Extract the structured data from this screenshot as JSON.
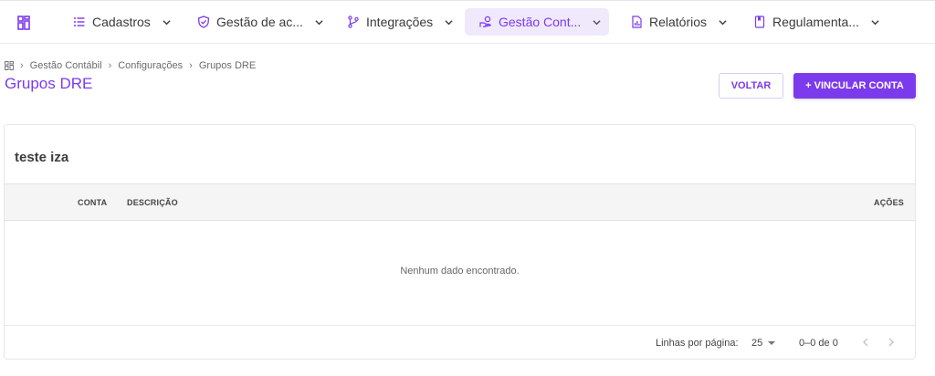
{
  "nav": {
    "items": [
      {
        "label": "Cadastros",
        "icon": "list-icon"
      },
      {
        "label": "Gestão de ac...",
        "icon": "shield-check-icon"
      },
      {
        "label": "Integrações",
        "icon": "git-branch-icon"
      },
      {
        "label": "Gestão Cont...",
        "icon": "hand-coins-icon",
        "active": true
      },
      {
        "label": "Relatórios",
        "icon": "report-chart-icon"
      },
      {
        "label": "Regulamenta...",
        "icon": "book-icon"
      }
    ],
    "accent_color": "#7c3aed",
    "active_bg": "#efe9fb"
  },
  "breadcrumb": [
    "Gestão Contábil",
    "Configurações",
    "Grupos DRE"
  ],
  "page": {
    "title": "Grupos DRE"
  },
  "actions": {
    "back_label": "VOLTAR",
    "link_label": "+ VINCULAR CONTA"
  },
  "card": {
    "title": "teste iza",
    "columns": {
      "conta": "CONTA",
      "descricao": "DESCRIÇÃO",
      "acoes": "AÇÕES"
    },
    "empty_text": "Nenhum dado encontrado.",
    "footer": {
      "rows_label": "Linhas por página:",
      "rows_value": "25",
      "range": "0–0 de 0"
    }
  }
}
